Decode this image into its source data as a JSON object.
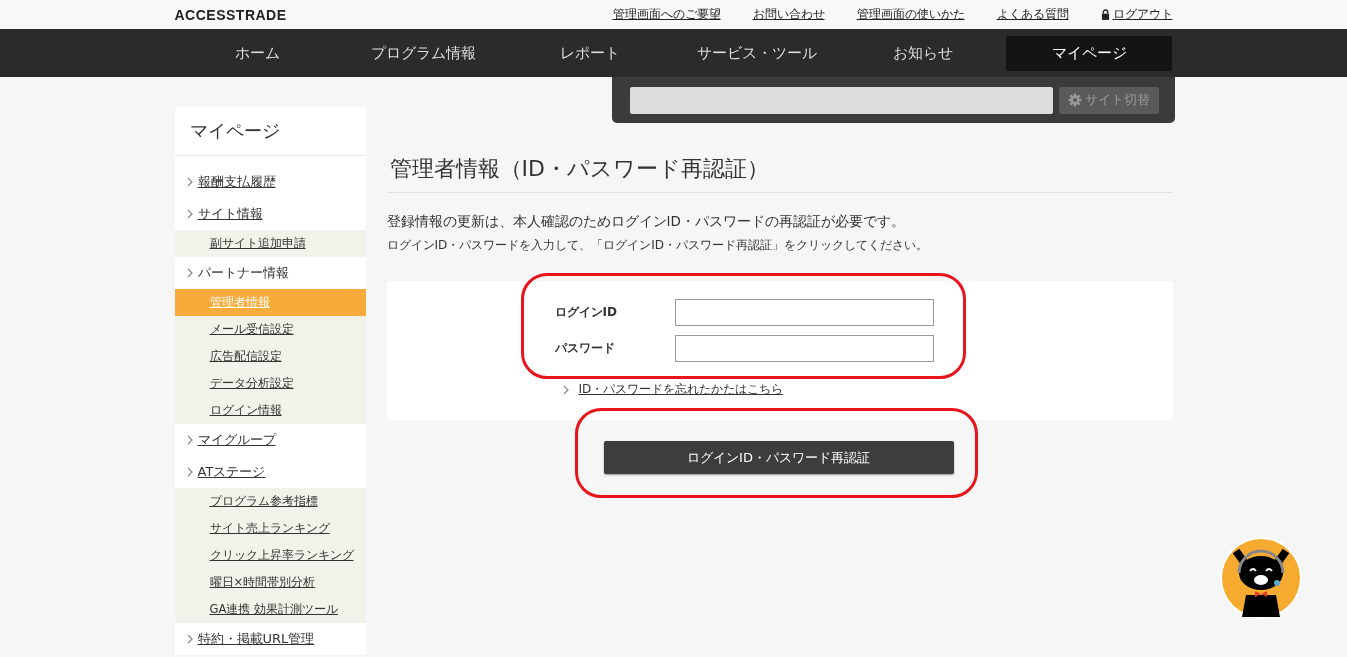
{
  "header": {
    "logo": "ACCESSTRADE",
    "links": [
      {
        "label": "管理画面へのご要望",
        "kind": "text"
      },
      {
        "label": "お問い合わせ",
        "kind": "text"
      },
      {
        "label": "管理画面の使いかた",
        "kind": "text"
      },
      {
        "label": "よくある質問",
        "kind": "text"
      },
      {
        "label": "ログアウト",
        "kind": "lock"
      }
    ]
  },
  "nav": [
    {
      "label": "ホーム",
      "selected": false
    },
    {
      "label": "プログラム情報",
      "selected": false
    },
    {
      "label": "レポート",
      "selected": false
    },
    {
      "label": "サービス・ツール",
      "selected": false
    },
    {
      "label": "お知らせ",
      "selected": false
    },
    {
      "label": "マイページ",
      "selected": true
    }
  ],
  "site_switch": {
    "button": "サイト切替"
  },
  "sidebar": {
    "title": "マイページ",
    "items": [
      {
        "label": "報酬支払履歴",
        "link": true
      },
      {
        "label": "サイト情報",
        "link": true,
        "children": [
          {
            "label": "副サイト追加申請",
            "selected": false
          }
        ]
      },
      {
        "label": "パートナー情報",
        "link": false,
        "children": [
          {
            "label": "管理者情報",
            "selected": true
          },
          {
            "label": "メール受信設定",
            "selected": false
          },
          {
            "label": "広告配信設定",
            "selected": false
          },
          {
            "label": "データ分析設定",
            "selected": false
          },
          {
            "label": "ログイン情報",
            "selected": false
          }
        ]
      },
      {
        "label": "マイグループ",
        "link": true
      },
      {
        "label": "ATステージ",
        "link": true,
        "children": [
          {
            "label": "プログラム参考指標",
            "selected": false
          },
          {
            "label": "サイト売上ランキング",
            "selected": false
          },
          {
            "label": "クリック上昇率ランキング",
            "selected": false
          },
          {
            "label": "曜日×時間帯別分析",
            "selected": false
          },
          {
            "label": "GA連携 効果計測ツール",
            "selected": false
          }
        ]
      },
      {
        "label": "特約・掲載URL管理",
        "link": true
      }
    ]
  },
  "main": {
    "title": "管理者情報（ID・パスワード再認証）",
    "description": "登録情報の更新は、本人確認のためログインID・パスワードの再認証が必要です。",
    "note": "ログインID・パスワードを入力して、「ログインID・パスワード再認証」をクリックしてください。",
    "fields": [
      {
        "label": "ログインID"
      },
      {
        "label": "パスワード"
      }
    ],
    "forgot_link": "ID・パスワードを忘れたかたはこちら",
    "submit": "ログインID・パスワード再認証"
  }
}
